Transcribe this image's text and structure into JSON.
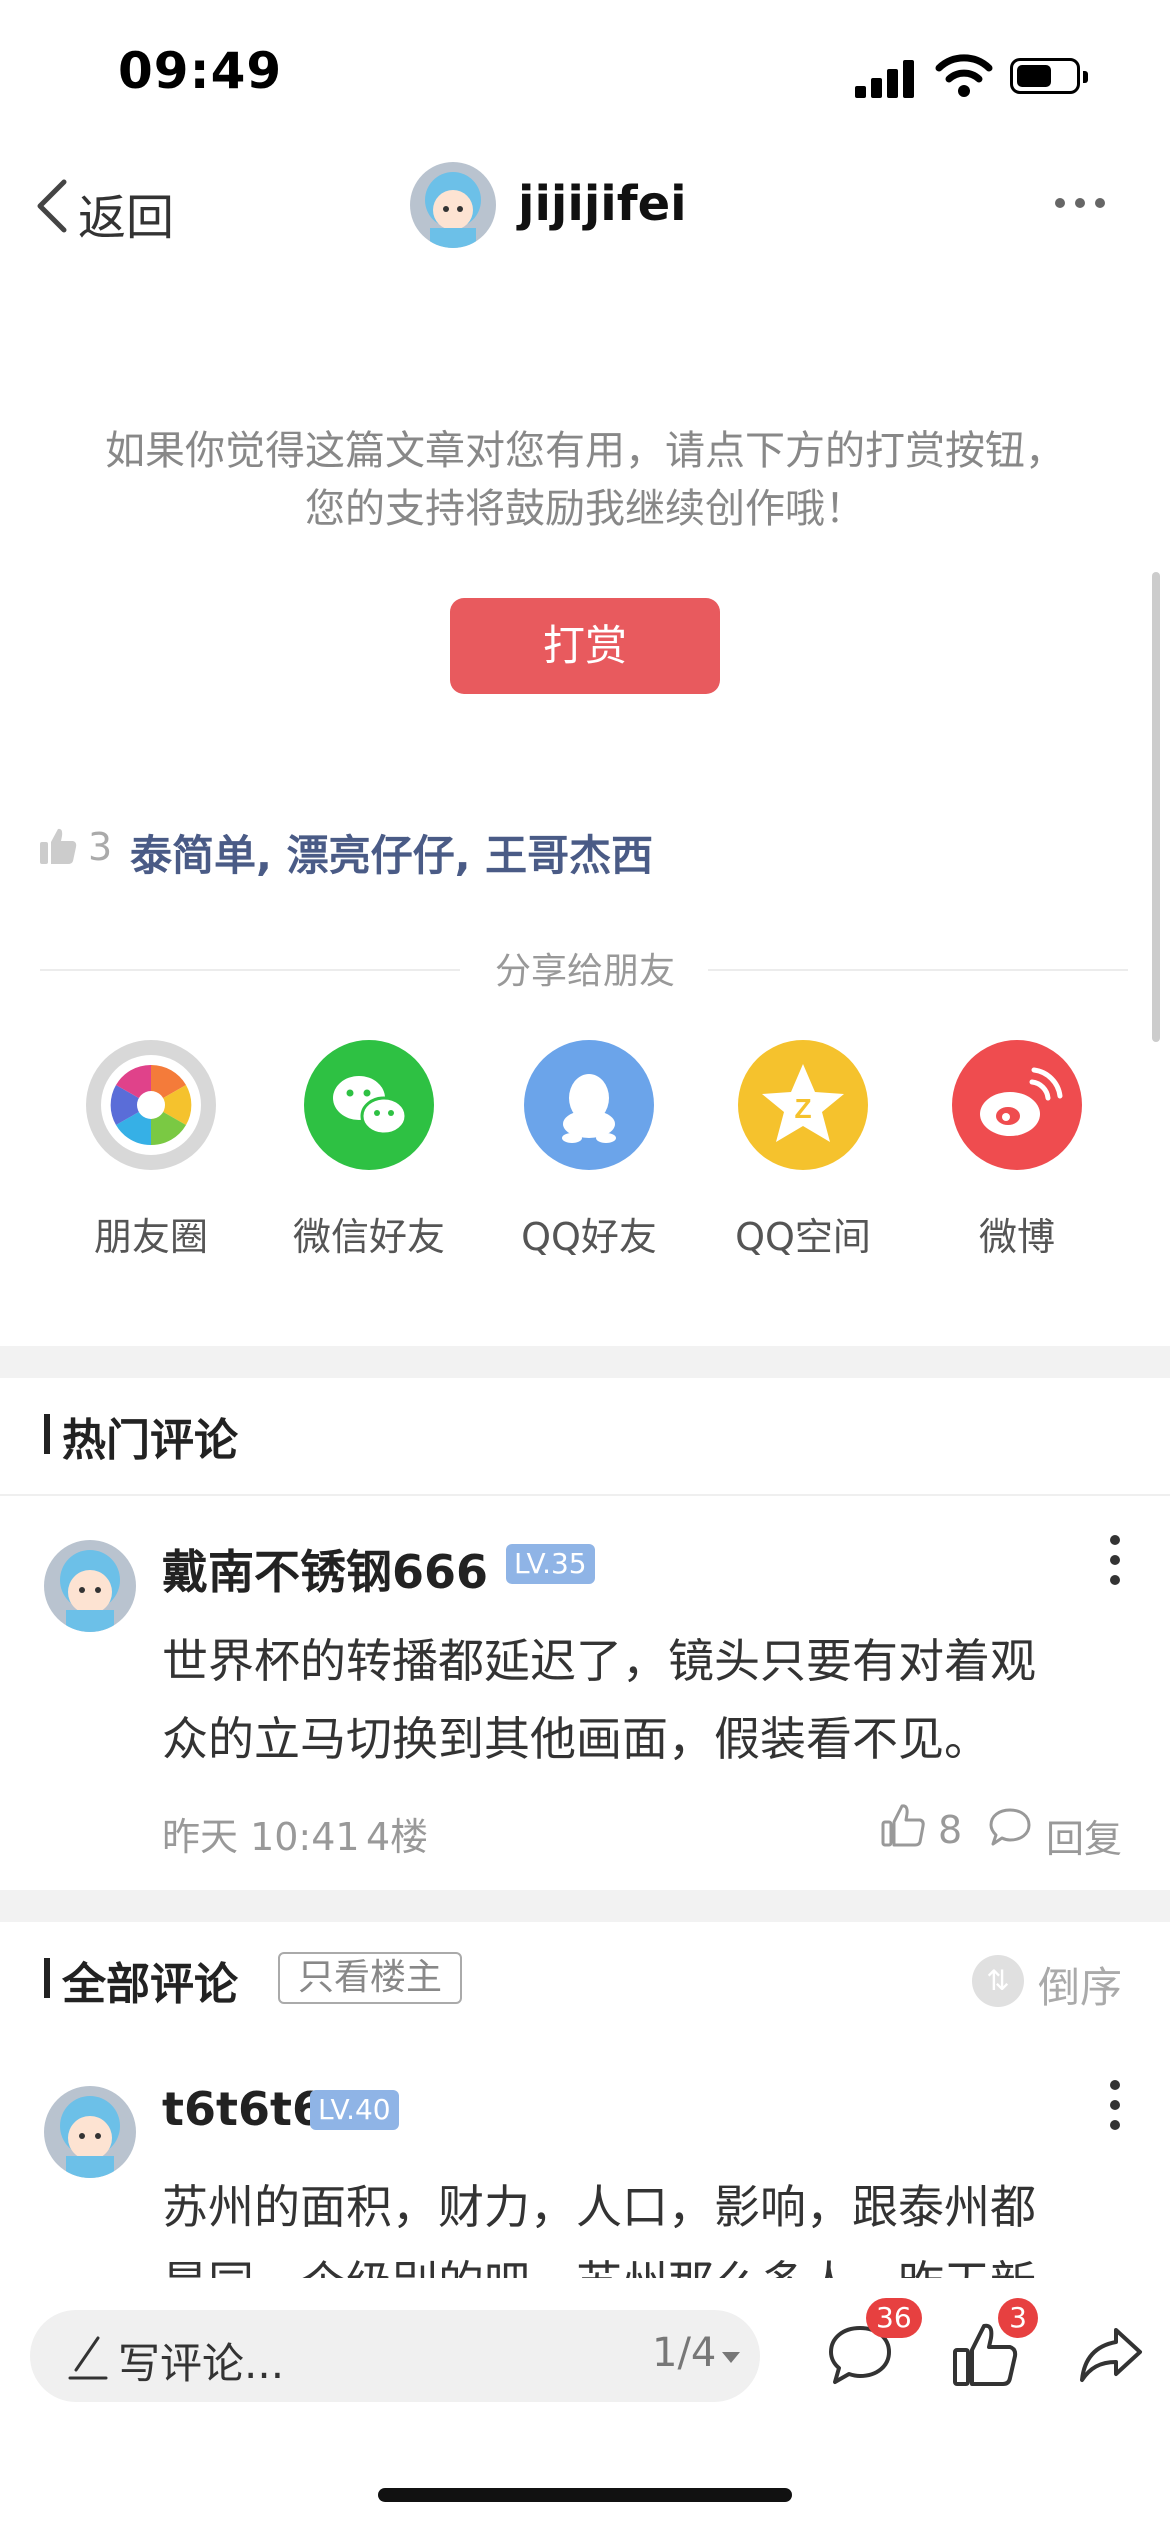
{
  "status": {
    "time": "09:49"
  },
  "nav": {
    "back": "返回",
    "username": "jijijifei"
  },
  "reward": {
    "text": "如果你觉得这篇文章对您有用，请点下方的打赏按钮，您的支持将鼓励我继续创作哦！",
    "button": "打赏"
  },
  "likes": {
    "count": "3",
    "names": "泰简单, 漂亮仔仔, 王哥杰西"
  },
  "share": {
    "title": "分享给朋友",
    "items": [
      {
        "label": "朋友圈",
        "icon": "moments-icon",
        "color": "#d8d8d8"
      },
      {
        "label": "微信好友",
        "icon": "wechat-icon",
        "color": "#2ec143"
      },
      {
        "label": "QQ好友",
        "icon": "qq-icon",
        "color": "#6ba4ea"
      },
      {
        "label": "QQ空间",
        "icon": "qzone-icon",
        "color": "#f5c22d"
      },
      {
        "label": "微博",
        "icon": "weibo-icon",
        "color": "#ef4c4f"
      }
    ]
  },
  "hot": {
    "title": "热门评论",
    "comment": {
      "user": "戴南不锈钢666",
      "level": "LV.35",
      "line1": "世界杯的转播都延迟了，镜头只要有对着观",
      "line2": "众的立马切换到其他画面，假装看不见。",
      "time": "昨天 10:41",
      "floor": "4楼",
      "likes": "8",
      "reply": "回复"
    }
  },
  "all": {
    "title": "全部评论",
    "filter": "只看楼主",
    "sort": "倒序",
    "comment": {
      "user": "t6t6t6",
      "level": "LV.40",
      "line1": "苏州的面积，财力，人口，影响，跟泰州都",
      "line2": "是同一个级别的吧，苏州那么多人，昨天新"
    }
  },
  "bottom": {
    "write": "写评论...",
    "page": "1/4",
    "comment_badge": "36",
    "like_badge": "3"
  }
}
